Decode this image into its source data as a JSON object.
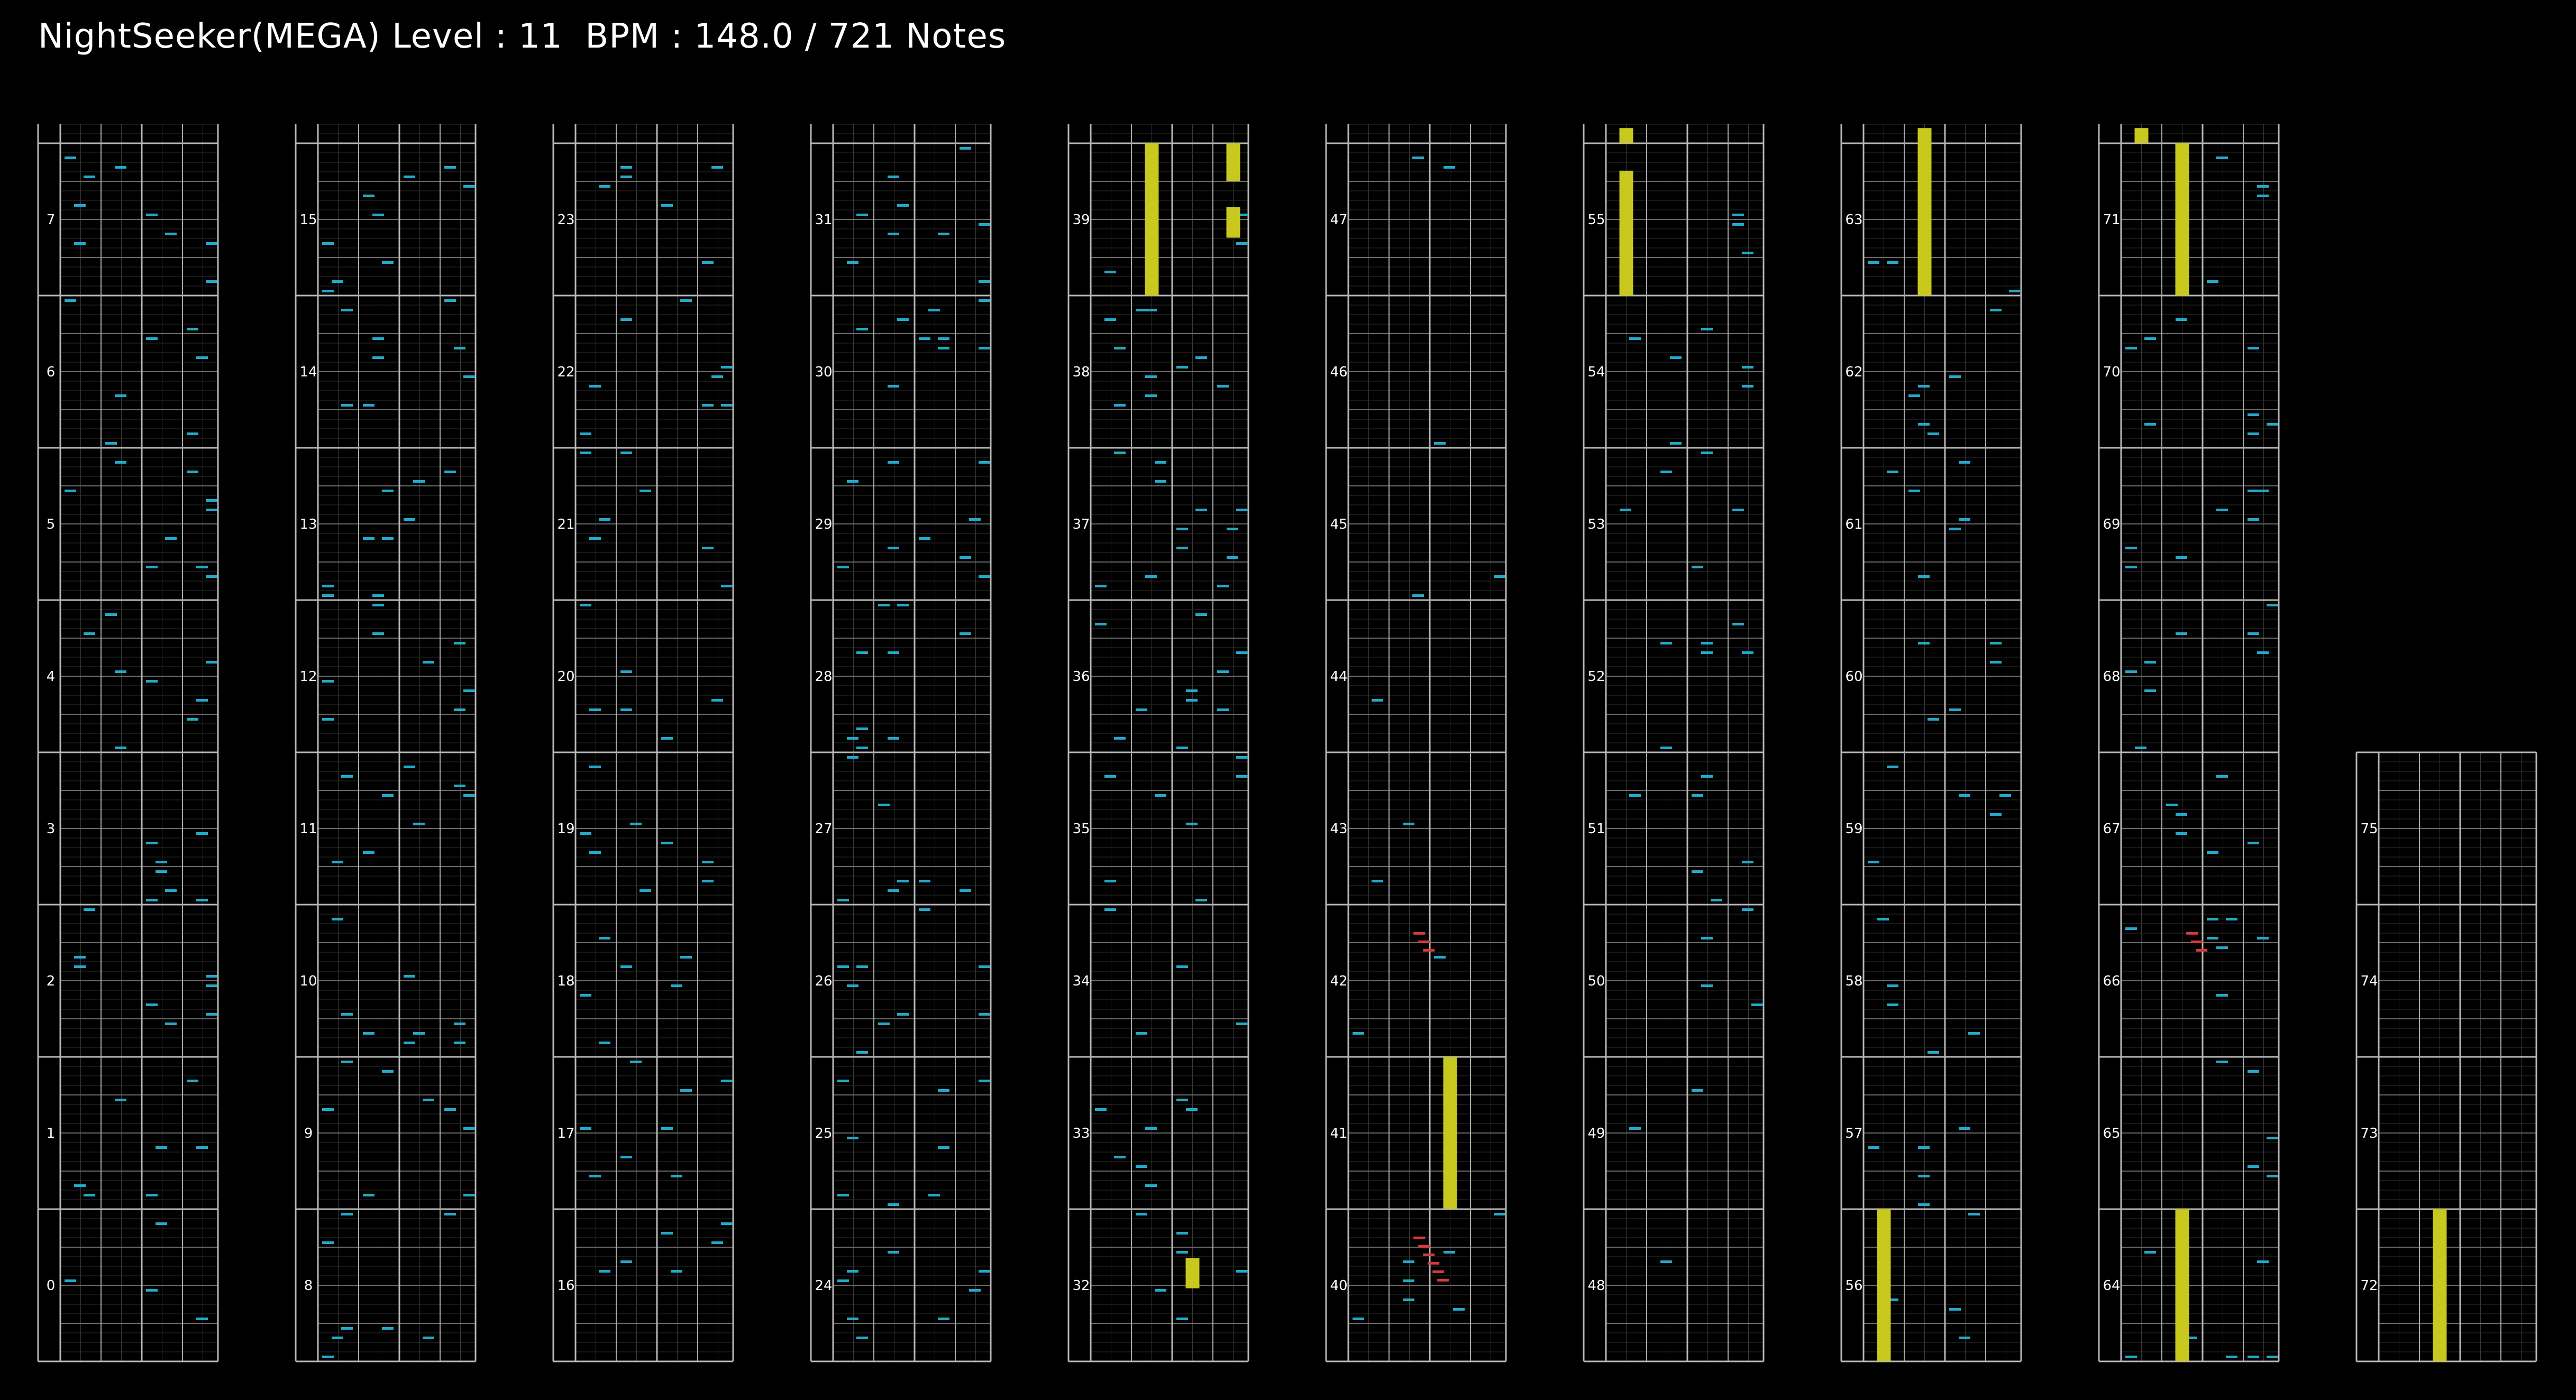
{
  "header": {
    "title": "NightSeeker(MEGA) Level : 11  BPM : 148.0 / 721 Notes"
  },
  "colors": {
    "background": "#000000",
    "frame": "#b8b8b8",
    "beat_line": "#6a6a6a",
    "sub_line": "#303030",
    "lane_line": "#a8a8a8",
    "center_line": "#3a3a3a",
    "note": "#22a9c9",
    "red_note": "#d63a3a",
    "hold": "#c8c81e",
    "label": "#ffffff"
  },
  "chart": {
    "columns": 10,
    "measures_per_column": 8,
    "total_measures": 76,
    "lanes": 4,
    "beats_per_measure": 4
  },
  "chart_data": {
    "type": "table",
    "song": "NightSeeker",
    "difficulty": "MEGA",
    "level": 11,
    "bpm": 148.0,
    "note_count": 721,
    "measure_labels": [
      "0",
      "1",
      "2",
      "3",
      "4",
      "5",
      "6",
      "7",
      "8",
      "9",
      "10",
      "11",
      "12",
      "13",
      "14",
      "15",
      "16",
      "17",
      "18",
      "19",
      "20",
      "21",
      "22",
      "23",
      "24",
      "25",
      "26",
      "27",
      "28",
      "29",
      "30",
      "31",
      "32",
      "33",
      "34",
      "35",
      "36",
      "37",
      "38",
      "39",
      "40",
      "41",
      "42",
      "43",
      "44",
      "45",
      "46",
      "47",
      "48",
      "49",
      "50",
      "51",
      "52",
      "53",
      "54",
      "55",
      "56",
      "57",
      "58",
      "59",
      "60",
      "61",
      "62",
      "63",
      "64",
      "65",
      "66",
      "67",
      "68",
      "69",
      "70",
      "71",
      "72",
      "73",
      "74",
      "75"
    ],
    "density": [
      4,
      7,
      8,
      7,
      8,
      9,
      7,
      9,
      8,
      9,
      9,
      8,
      9,
      9,
      8,
      9,
      6,
      8,
      6,
      8,
      6,
      8,
      8,
      7,
      8,
      8,
      9,
      8,
      9,
      9,
      9,
      10,
      6,
      8,
      4,
      7,
      11,
      12,
      10,
      3,
      7,
      0,
      2,
      2,
      1,
      2,
      1,
      2,
      1,
      2,
      4,
      6,
      6,
      5,
      6,
      3,
      4,
      5,
      5,
      5,
      6,
      6,
      6,
      4,
      7,
      6,
      7,
      6,
      8,
      7,
      8,
      4,
      0,
      0,
      0,
      0
    ],
    "holds": [
      {
        "measure": 32,
        "lane": 2,
        "start": 0.48,
        "end": 0.68
      },
      {
        "measure": 39,
        "lane": 1,
        "start": 0.0,
        "end": 1.0
      },
      {
        "measure": 39,
        "lane": 3,
        "start": 0.38,
        "end": 0.58
      },
      {
        "measure": 39,
        "lane": 3,
        "start": 0.75,
        "end": 1.0
      },
      {
        "measure": 41,
        "lane": 2,
        "start": 0.0,
        "end": 1.0
      },
      {
        "measure": 55,
        "lane": 0,
        "start": 0.0,
        "end": 0.82
      },
      {
        "measure": 55,
        "lane": 0,
        "start": 1.0,
        "end": 1.1
      },
      {
        "measure": 56,
        "lane": 0,
        "start": 0.0,
        "end": 1.0
      },
      {
        "measure": 63,
        "lane": 1,
        "start": 0.0,
        "end": 1.1
      },
      {
        "measure": 64,
        "lane": 1,
        "start": 0.0,
        "end": 1.0
      },
      {
        "measure": 71,
        "lane": 1,
        "start": 0.0,
        "end": 1.0
      },
      {
        "measure": 71,
        "lane": 0,
        "start": 1.0,
        "end": 1.1
      },
      {
        "measure": 72,
        "lane": 1,
        "start": 0.0,
        "end": 1.0
      }
    ],
    "red_groups": [
      {
        "measure": 40,
        "count": 6
      },
      {
        "measure": 42,
        "count": 3
      },
      {
        "measure": 66,
        "count": 3
      }
    ]
  }
}
